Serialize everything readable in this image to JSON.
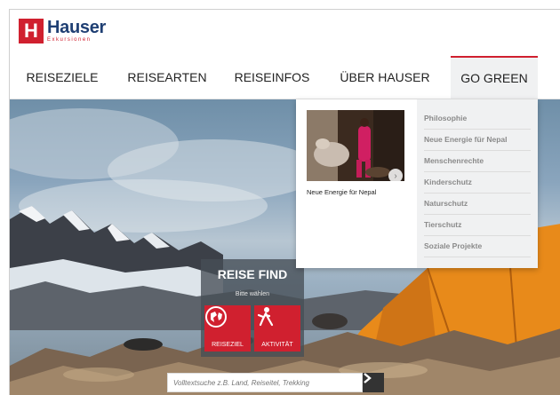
{
  "logo": {
    "name": "Hauser",
    "subtitle": "Exkursionen",
    "mark": "H"
  },
  "nav": {
    "items": [
      {
        "label": "REISEZIELE"
      },
      {
        "label": "REISEARTEN"
      },
      {
        "label": "REISEINFOS"
      },
      {
        "label": "ÜBER HAUSER"
      },
      {
        "label": "GO GREEN"
      }
    ],
    "active": "GO GREEN"
  },
  "finder": {
    "title": "REISE FIND",
    "subtitle": "Bitte wählen",
    "buttons": [
      {
        "label": "REISEZIEL",
        "icon": "globe-icon"
      },
      {
        "label": "AKTIVITÄT",
        "icon": "hiker-icon"
      }
    ]
  },
  "search": {
    "placeholder": "Volltextsuche z.B. Land, Reiseitel, Trekking",
    "button_icon": "chevron-right-icon"
  },
  "dropdown": {
    "feature_caption": "Neue Energie für Nepal",
    "links": [
      {
        "label": "Philosophie"
      },
      {
        "label": "Neue Energie für Nepal"
      },
      {
        "label": "Menschenrechte"
      },
      {
        "label": "Kinderschutz"
      },
      {
        "label": "Naturschutz"
      },
      {
        "label": "Tierschutz"
      },
      {
        "label": "Soziale Projekte"
      }
    ]
  },
  "colors": {
    "brand_red": "#d0202f",
    "brand_blue": "#1f3f73",
    "tent_orange": "#e88a1a"
  }
}
